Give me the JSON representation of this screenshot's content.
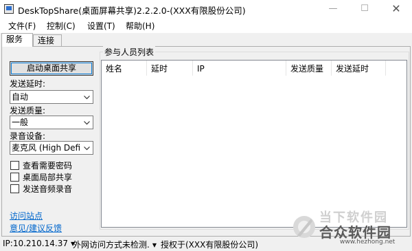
{
  "window": {
    "title": "DeskTopShare(桌面屏幕共享)2.2.2.0-(XXX有限股份公司)",
    "minimize": "—",
    "maximize": "☐",
    "close": "✕"
  },
  "menu": [
    "文件(F)",
    "控制(C)",
    "设置(T)",
    "帮助(H)"
  ],
  "tabs": [
    "服务",
    "连接"
  ],
  "sidebar": {
    "start_button": "启动桌面共享",
    "delay_label": "发送延时:",
    "delay_value": "自动",
    "quality_label": "发送质量:",
    "quality_value": "一般",
    "audio_label": "录音设备:",
    "audio_value": "麦克风 (High Defi",
    "checkboxes": [
      "查看需要密码",
      "桌面局部共享",
      "发送音频录音"
    ],
    "links": [
      "访问站点",
      "意见/建议反馈"
    ]
  },
  "participants": {
    "title": "参与人员列表",
    "columns": [
      "姓名",
      "延时",
      "IP",
      "发送质量",
      "发送延时"
    ]
  },
  "status": {
    "ip": "IP:10.210.14.37",
    "external": "外网访问方式未检测.",
    "license": "授权于(XXX有限股份公司)"
  },
  "watermark": {
    "line1": "当下软件园",
    "line2": "合众软件园",
    "url": "www.hezhong.net"
  }
}
